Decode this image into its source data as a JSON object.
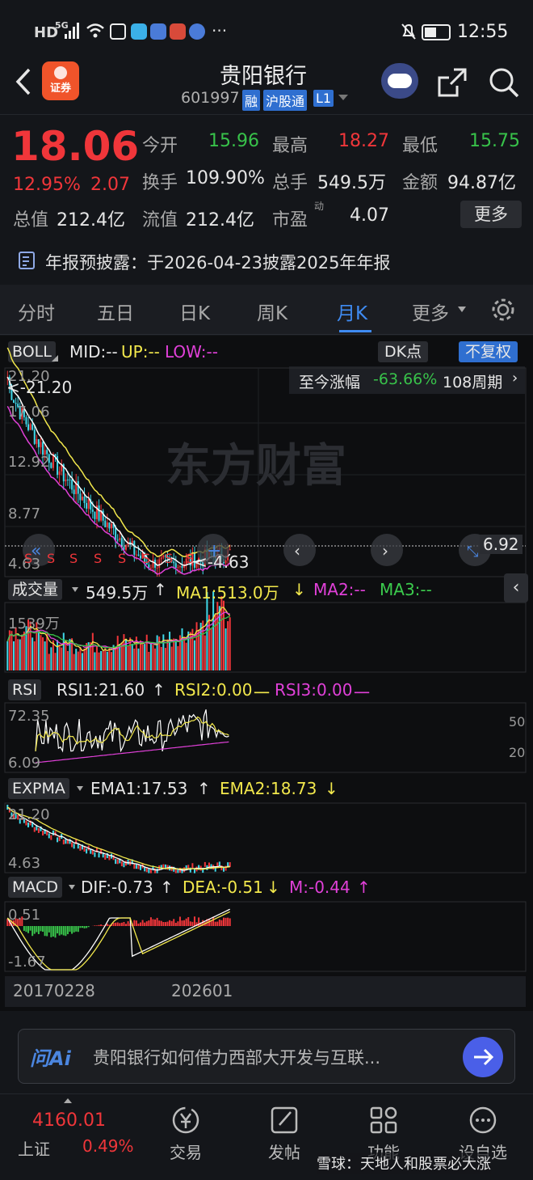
{
  "status_bar": {
    "network": "HD",
    "signal": "5G",
    "time": "12:55"
  },
  "header": {
    "back_icon": "chevron-left-icon",
    "broker_logo_text": "证券",
    "stock_name": "贵阳银行",
    "stock_code": "601997",
    "badge_margin": "融",
    "badge_connect": "沪股通",
    "badge_level": "L1",
    "share_icon": "share-icon",
    "search_icon": "search-icon"
  },
  "quote": {
    "price": "18.06",
    "change_pct": "12.95%",
    "change_amt": "2.07",
    "open_label": "今开",
    "open_value": "15.96",
    "high_label": "最高",
    "high_value": "18.27",
    "low_label": "最低",
    "low_value": "15.75",
    "turnover_label": "换手",
    "turnover_value": "109.90%",
    "volume_label": "总手",
    "volume_value": "549.5万",
    "amount_label": "金额",
    "amount_value": "94.87亿",
    "mktcap_label": "总值",
    "mktcap_value": "212.4亿",
    "float_label": "流值",
    "float_value": "212.4亿",
    "pe_label": "市盈",
    "pe_sup": "动",
    "pe_value": "4.07",
    "more_label": "更多",
    "notice": "年报预披露：于2026-04-23披露2025年年报"
  },
  "tabs": [
    "分时",
    "五日",
    "日K",
    "周K",
    "月K",
    "更多"
  ],
  "active_tab": "月K",
  "chart": {
    "boll": {
      "tag": "BOLL",
      "mid": "MID:--",
      "up": "UP:--",
      "low": "LOW:--",
      "dk_button": "DK点",
      "adjust_button": "不复权",
      "range_label": "至今涨幅",
      "range_value": "-63.66%",
      "range_periods": "108周期",
      "y_top": "21.20",
      "y_2": "17.06",
      "y_3": "12.92",
      "y_4": "8.77",
      "y_bottom": "4.63",
      "max_marker": "<-21.20",
      "min_marker": "<-4.63",
      "last_value": "6.92",
      "watermark": "东方财富",
      "s_marker": "S"
    },
    "volume": {
      "tag": "成交量",
      "value": "549.5万",
      "value_arrow": "↑",
      "ma1": "MA1:513.0万",
      "ma1_arrow": "↓",
      "ma2": "MA2:--",
      "ma3": "MA3:--",
      "y_top": "1539万"
    },
    "rsi": {
      "tag": "RSI",
      "rsi1": "RSI1:21.60",
      "rsi1_arrow": "↑",
      "rsi2": "RSI2:0.00",
      "rsi2_dash": "一",
      "rsi3": "RSI3:0.00",
      "rsi3_dash": "一",
      "y_top": "72.35",
      "y_bottom": "6.09",
      "ref_50": "50",
      "ref_20": "20"
    },
    "expma": {
      "tag": "EXPMA",
      "ema1": "EMA1:17.53",
      "ema1_arrow": "↑",
      "ema2": "EMA2:18.73",
      "ema2_arrow": "↓",
      "y_top": "21.20",
      "y_bottom": "4.63"
    },
    "macd": {
      "tag": "MACD",
      "dif": "DIF:-0.73",
      "dif_arrow": "↑",
      "dea": "DEA:-0.51",
      "dea_arrow": "↓",
      "m": "M:-0.44",
      "m_arrow": "↑",
      "y_top": "0.51",
      "y_bottom": "-1.67"
    },
    "x_start": "20170228",
    "x_end": "202601"
  },
  "ai_bar": {
    "logo": "问Ai",
    "prompt": "贵阳银行如何借力西部大开发与互联..."
  },
  "bottom_nav": {
    "index_value": "4160.01",
    "index_name": "上证",
    "index_change": "0.49%",
    "trade": "交易",
    "post": "发帖",
    "functions": "功能",
    "custom": "设自选",
    "watermark": "雪球：天地人和股票必大涨"
  },
  "colors": {
    "up_red": "#f0363a",
    "down_green": "#38c24a",
    "accent_blue": "#2f7bea",
    "yellow_line": "#f2e84c",
    "magenta_line": "#e040d8",
    "white_line": "#ffffff"
  }
}
